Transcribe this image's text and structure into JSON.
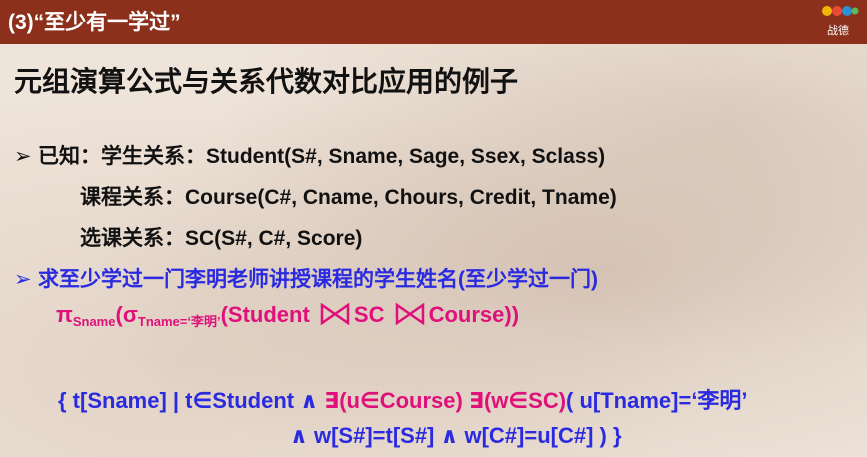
{
  "header": {
    "title": "(3)“至少有一学过”",
    "logo_text": "战德"
  },
  "heading": "元组演算公式与关系代数对比应用的例子",
  "known": {
    "bullet": "➢",
    "lead": "已知：学生关系：",
    "student_schema": "Student(S#, Sname, Sage, Ssex, Sclass)",
    "course_label": "课程关系：",
    "course_schema": "Course(C#, Cname, Chours, Credit, Tname)",
    "sc_label": "选课关系：",
    "sc_schema": "SC(S#, C#, Score)"
  },
  "query": {
    "bullet": "➢",
    "text": "求至少学过一门李明老师讲授课程的学生姓名(至少学过一门)"
  },
  "algebra": {
    "pi": "π",
    "pi_sub": "Sname",
    "open1": "(",
    "sigma": "σ",
    "sigma_sub": "Tname=‘李明’",
    "open2": "(Student",
    "sc": "SC",
    "course": "Course))"
  },
  "calculus": {
    "part1": "{ t[Sname] | t∈Student ∧ ",
    "exists1": "∃(u∈Course) ∃(w∈SC)",
    "part2": "( u[Tname]=‘李明’",
    "line2": "∧ w[S#]=t[S#] ∧ w[C#]=u[C#] ) }"
  },
  "colors": {
    "titlebar": "#8c2f1b",
    "blue": "#2a2ae0",
    "magenta": "#e0107a"
  }
}
